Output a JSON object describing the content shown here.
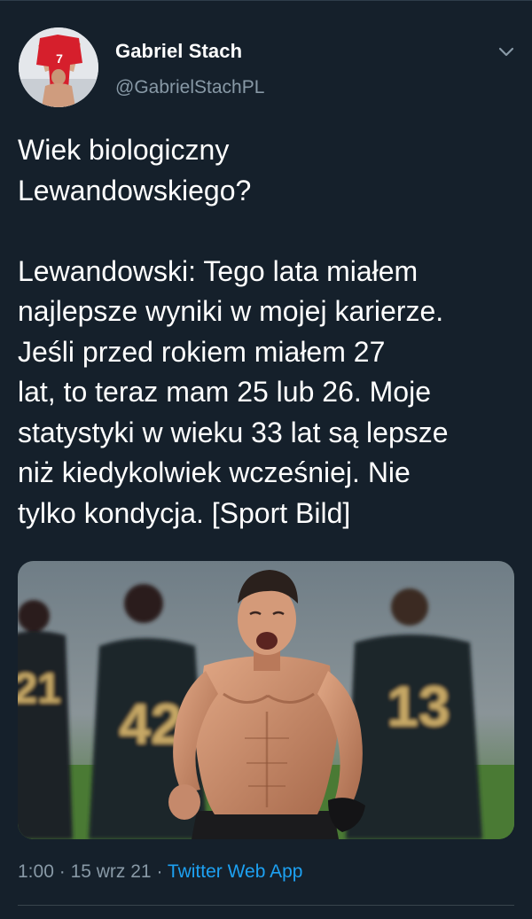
{
  "tweet": {
    "author": {
      "display_name": "Gabriel Stach",
      "handle": "@GabrielStachPL"
    },
    "text": "Wiek biologiczny\nLewandowskiego?\n\nLewandowski: Tego lata miałem\nnajlepsze wyniki w mojej karierze.\nJeśli przed rokiem miałem 27\nlat, to teraz mam 25 lub 26. Moje\nstatystyki w wieku 33 lat są lepsze\nniż kiedykolwiek wcześniej. Nie\ntylko kondycja. [Sport Bild]",
    "media": {
      "type": "photo",
      "jersey_numbers": [
        "21",
        "42",
        "13"
      ]
    },
    "time": "1:00",
    "separator": "·",
    "date": "15 wrz 21",
    "source": "Twitter Web App"
  },
  "colors": {
    "background": "#15202b",
    "text_primary": "#ffffff",
    "text_secondary": "#8899a6",
    "accent": "#1da1f2"
  },
  "icons": {
    "menu": "chevron-down-icon"
  }
}
